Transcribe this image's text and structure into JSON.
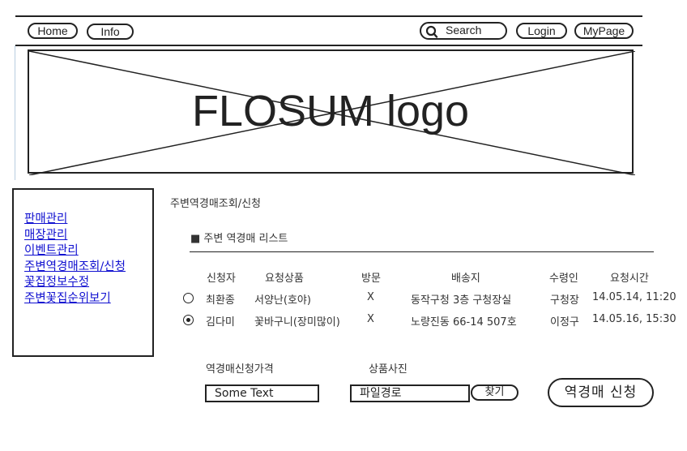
{
  "nav": {
    "home": "Home",
    "info": "Info",
    "search": "Search",
    "login": "Login",
    "mypage": "MyPage"
  },
  "logo": {
    "text": "FLOSUM logo"
  },
  "sidebar": {
    "items": [
      {
        "label": "판매관리"
      },
      {
        "label": "매장관리"
      },
      {
        "label": "이벤트관리"
      },
      {
        "label": "주변역경매조회/신청"
      },
      {
        "label": "꽃집정보수정"
      },
      {
        "label": "주변꽃집순위보기"
      }
    ]
  },
  "main": {
    "page_title": "주변역경매조회/신청",
    "section_title": "■ 주변 역경매 리스트",
    "table": {
      "headers": [
        "신청자",
        "요청상품",
        "방문",
        "배송지",
        "수령인",
        "요청시간"
      ],
      "rows": [
        {
          "selected": false,
          "cells": [
            "최환종",
            "서양난(호야)",
            "X",
            "동작구청 3층 구청장실",
            "구청장",
            "14.05.14, 11:20"
          ]
        },
        {
          "selected": true,
          "cells": [
            "김다미",
            "꽃바구니(장미많이)",
            "X",
            "노량진동 66-14 507호",
            "이정구",
            "14.05.16, 15:30"
          ]
        }
      ]
    },
    "form": {
      "price_label": "역경매신청가격",
      "price_value": "Some Text",
      "photo_label": "상품사진",
      "photo_path": "파일경로",
      "find_button": "찾기",
      "submit_button": "역경매 신청"
    }
  }
}
